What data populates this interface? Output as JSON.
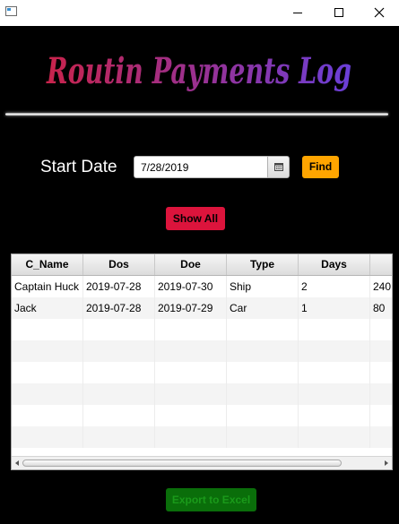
{
  "window": {
    "title": "",
    "icon": "java-window-icon",
    "controls": [
      "minimize-icon",
      "maximize-icon",
      "close-icon"
    ]
  },
  "logo": {
    "text": "Routin Payments Log",
    "gradient_start": "#c8234b",
    "gradient_end": "#6a3fd8"
  },
  "filter": {
    "start_label": "Start Date",
    "date_value": "7/28/2019",
    "calendar_icon": "calendar-icon",
    "find_label": "Find",
    "find_color": "#ffa500"
  },
  "show_all": {
    "label": "Show All",
    "color": "#dc143c"
  },
  "table": {
    "columns": [
      "C_Name",
      "Dos",
      "Doe",
      "Type",
      "Days",
      ""
    ],
    "rows": [
      [
        "Captain Huck",
        "2019-07-28",
        "2019-07-30",
        "Ship",
        "2",
        "240"
      ],
      [
        "Jack",
        "2019-07-28",
        "2019-07-29",
        "Car",
        "1",
        "80"
      ]
    ]
  },
  "export": {
    "label": "Export to Excel",
    "color": "#0a6e0a"
  }
}
